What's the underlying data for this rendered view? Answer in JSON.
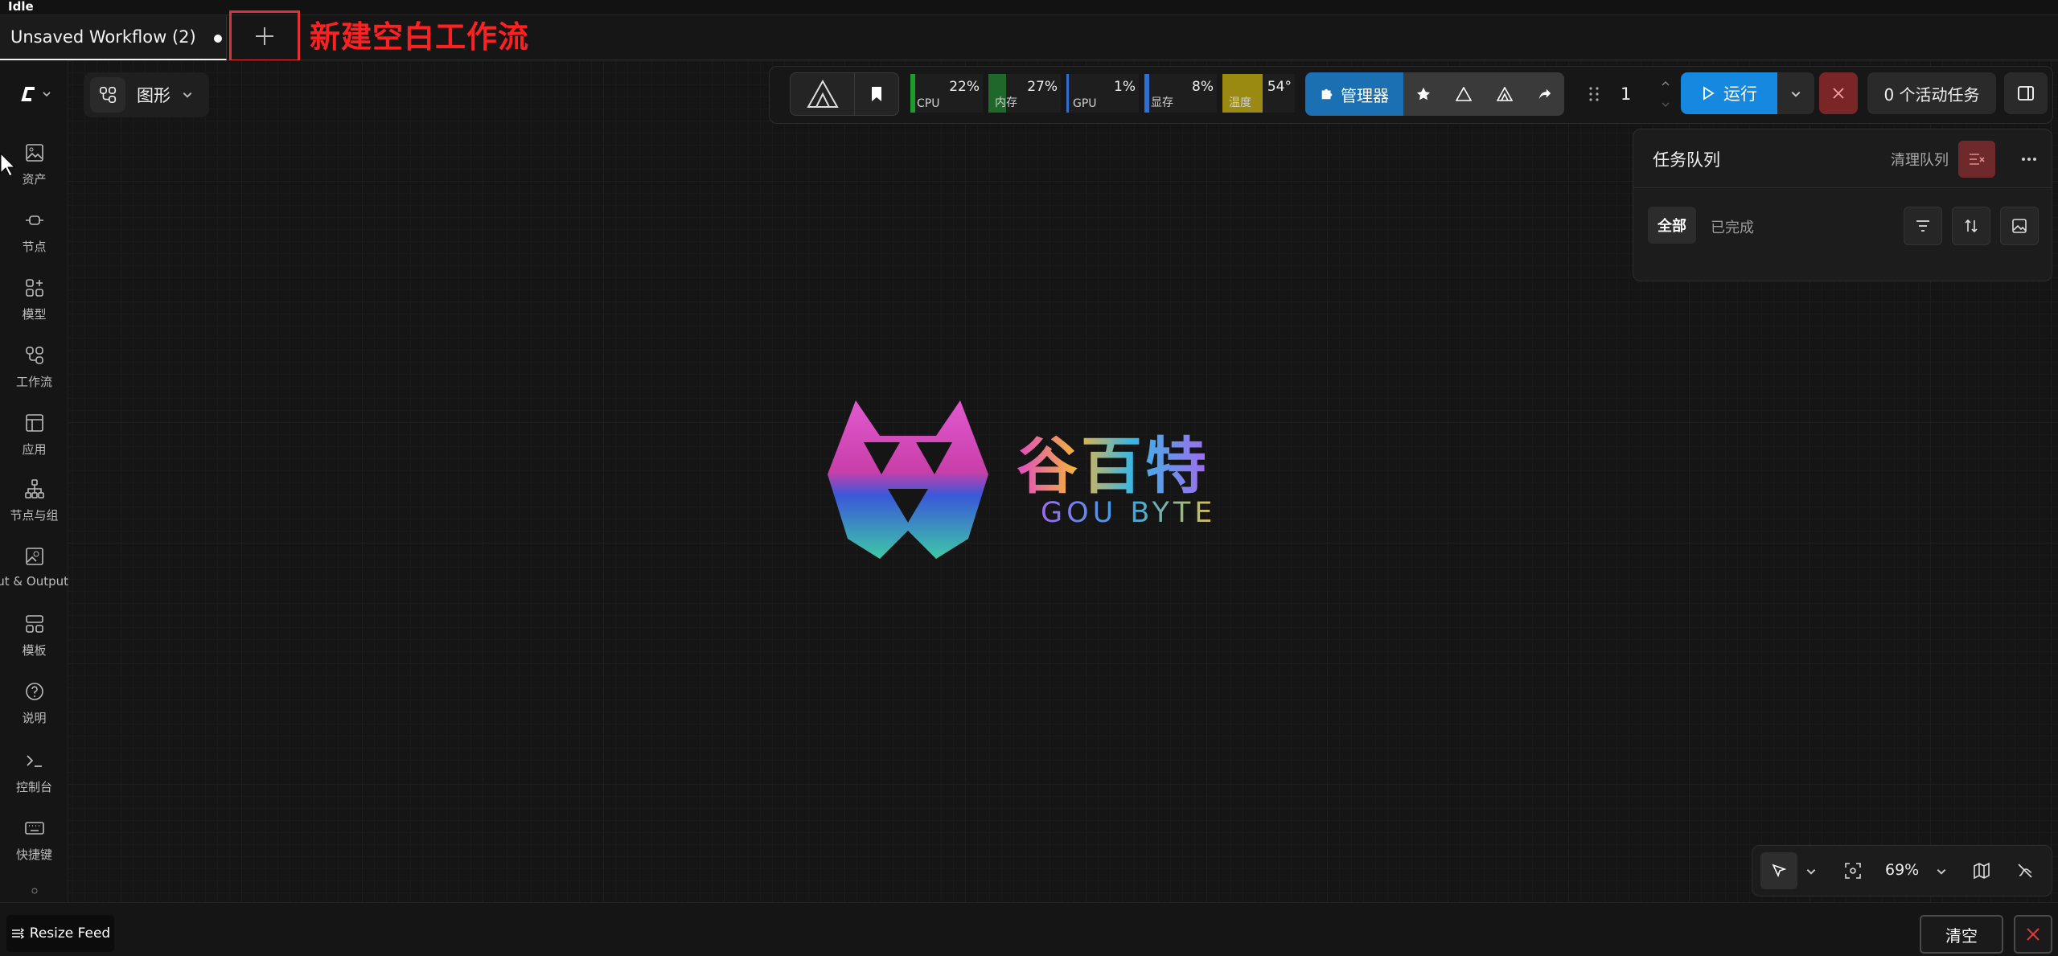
{
  "titlebar": {
    "status": "Idle"
  },
  "tabs": [
    {
      "label": "Unsaved Workflow (2)",
      "modified": true
    }
  ],
  "new_tab_annotation": "新建空白工作流",
  "sidebar": {
    "items": [
      {
        "label": "资产",
        "icon": "image-icon"
      },
      {
        "label": "节点",
        "icon": "node-icon"
      },
      {
        "label": "模型",
        "icon": "model-icon"
      },
      {
        "label": "工作流",
        "icon": "workflow-icon"
      },
      {
        "label": "应用",
        "icon": "app-icon"
      },
      {
        "label": "节点与组",
        "icon": "hierarchy-icon"
      },
      {
        "label": "Input & Output",
        "icon": "image-io-icon"
      },
      {
        "label": "模板",
        "icon": "template-icon"
      },
      {
        "label": "说明",
        "icon": "help-icon"
      },
      {
        "label": "控制台",
        "icon": "terminal-icon"
      },
      {
        "label": "快捷键",
        "icon": "keyboard-icon"
      }
    ]
  },
  "graph_mode": {
    "label": "图形"
  },
  "monitors": [
    {
      "label": "CPU",
      "value": "22%",
      "color": "#1f9a2e"
    },
    {
      "label": "内存",
      "value": "27%",
      "color": "#1f9a2e"
    },
    {
      "label": "GPU",
      "value": "1%",
      "color": "#2f6fd0"
    },
    {
      "label": "显存",
      "value": "8%",
      "color": "#2f6fd0"
    },
    {
      "label": "温度",
      "value": "54°",
      "color": "#9a8a12"
    }
  ],
  "manager": {
    "label": "管理器"
  },
  "batch": {
    "count": "1"
  },
  "run": {
    "label": "运行"
  },
  "active_jobs": {
    "label": "0 个活动任务"
  },
  "queue": {
    "title": "任务队列",
    "clear_label": "清理队列",
    "tab_all": "全部",
    "tab_done": "已完成"
  },
  "brand": {
    "cn": "谷百特",
    "en": "GOU BYTE"
  },
  "canvas_controls": {
    "zoom": "69%"
  },
  "bottom": {
    "resize_feed": "Resize Feed",
    "clear": "清空"
  },
  "colors": {
    "accent": "#1688e0",
    "manager": "#1b6fb3",
    "danger": "#7a2626",
    "annotation": "#ff2020"
  }
}
